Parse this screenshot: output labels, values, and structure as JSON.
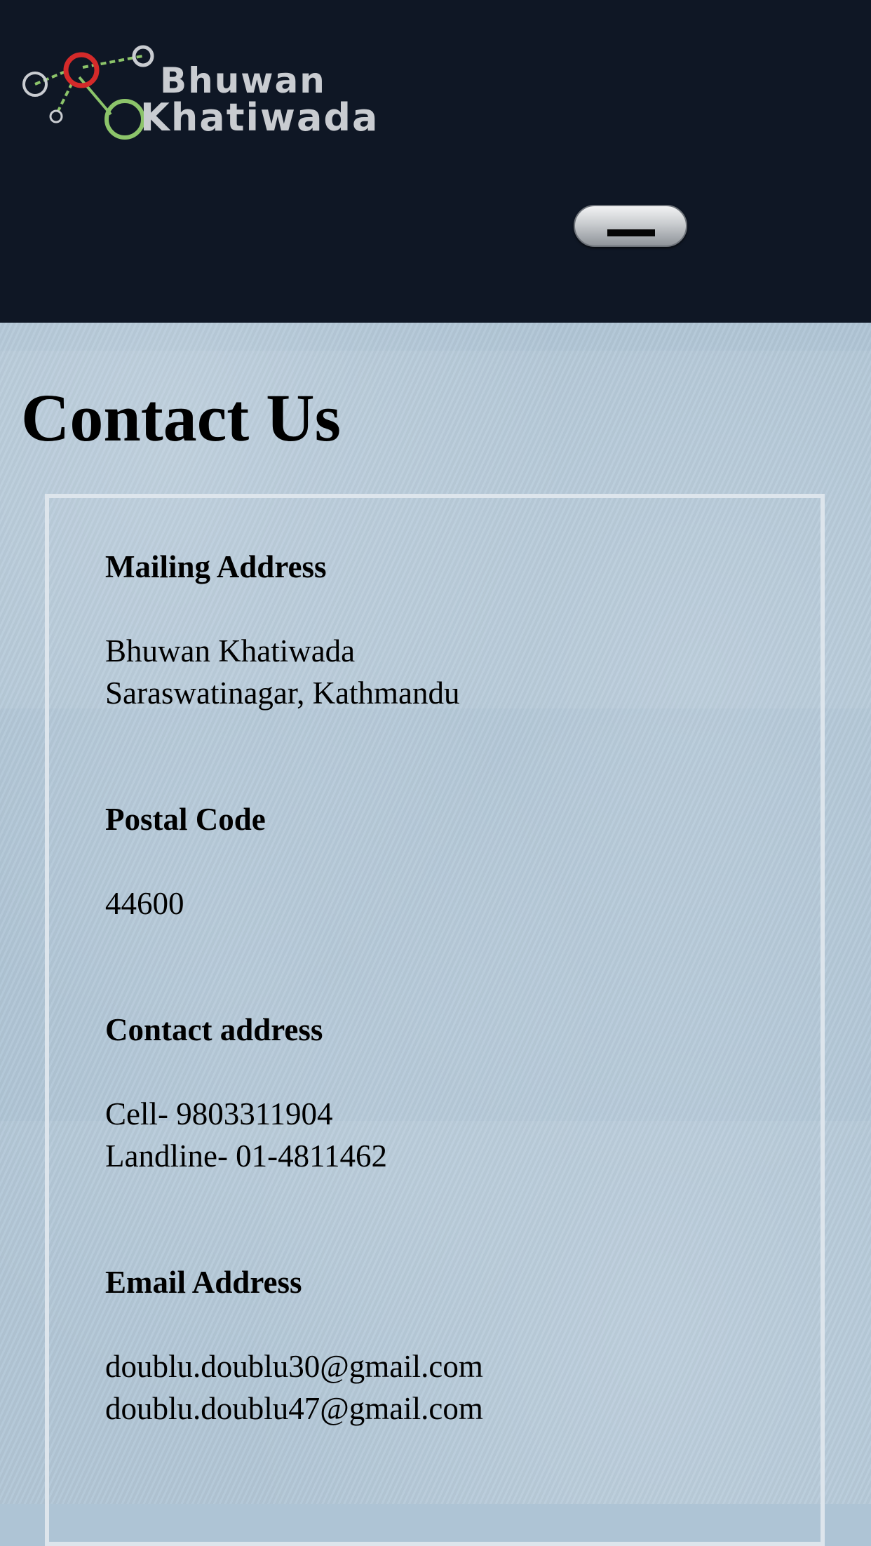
{
  "header": {
    "logo": {
      "line1": "Bhuwan",
      "line2": "Khatiwada"
    },
    "menu_button_icon": "menu-bar-icon"
  },
  "main": {
    "title": "Contact Us",
    "sections": [
      {
        "heading": "Mailing Address",
        "lines": [
          "Bhuwan Khatiwada",
          "Saraswatinagar, Kathmandu"
        ]
      },
      {
        "heading": "Postal Code",
        "lines": [
          "44600"
        ]
      },
      {
        "heading": "Contact address",
        "lines": [
          "Cell- 9803311904",
          "Landline- 01-4811462"
        ]
      },
      {
        "heading": "Email Address",
        "lines": [
          "doublu.doublu30@gmail.com",
          "doublu.doublu47@gmail.com"
        ]
      }
    ]
  },
  "colors": {
    "header_bg": "#0f1725",
    "content_bg": "#aec4d5",
    "logo_red": "#d42a2a",
    "logo_green": "#8cc46a",
    "logo_text": "#c9ccd1"
  }
}
